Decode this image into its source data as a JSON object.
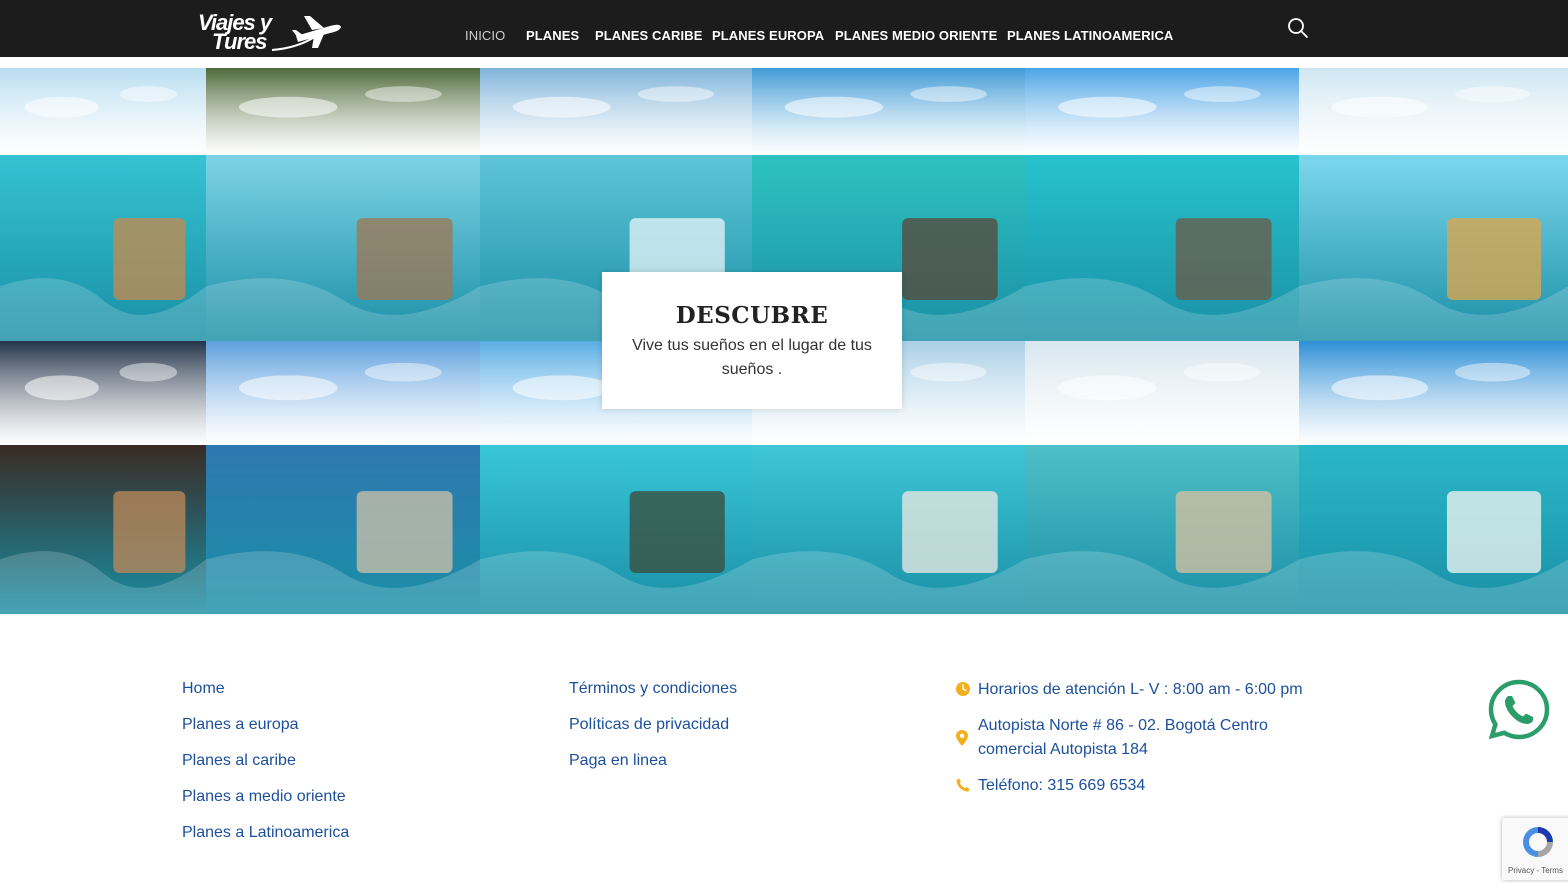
{
  "header": {
    "logo_line1": "Viajes y",
    "logo_line2": "Tures",
    "nav": [
      {
        "label": "INICIO",
        "active": true
      },
      {
        "label": "PLANES",
        "active": false
      },
      {
        "label": "PLANES CARIBE",
        "active": false
      },
      {
        "label": "PLANES EUROPA",
        "active": false
      },
      {
        "label": "PLANES MEDIO ORIENTE",
        "active": false
      },
      {
        "label": "PLANES LATINOAMERICA",
        "active": false
      }
    ],
    "search_icon": "search-icon"
  },
  "gallery": {
    "tiles": [
      {
        "subject": "overwater-breakfast-table",
        "sky": "#b8ddf0",
        "sea": "#35c3d2",
        "accent": "#c98a4a"
      },
      {
        "subject": "cliff-pool-villa",
        "sky": "#4e6a3a",
        "sea": "#7fd3e6",
        "accent": "#a07550"
      },
      {
        "subject": "water-bottle-pour",
        "sky": "#7fb3da",
        "sea": "#5fc5d8",
        "accent": "#e8f4f8"
      },
      {
        "subject": "overwater-bungalow-pier",
        "sky": "#3f9ad6",
        "sea": "#2ec2c0",
        "accent": "#5a4636"
      },
      {
        "subject": "ocean-villa-distance",
        "sky": "#4aa3e6",
        "sea": "#27c3cc",
        "accent": "#6e5a44"
      },
      {
        "subject": "cave-pool-breakfast",
        "sky": "#cfe6f2",
        "sea": "#7dd8ee",
        "accent": "#e2a548"
      },
      {
        "subject": "night-couple-mountain",
        "sky": "#24344a",
        "sea": "#3a2b24",
        "accent": "#c08a5a"
      },
      {
        "subject": "rock-tub-island",
        "sky": "#5d9fde",
        "sea": "#2f78b0",
        "accent": "#cfc2a8"
      },
      {
        "subject": "lagoon-bungalows",
        "sky": "#5aaee6",
        "sea": "#39c7d8",
        "accent": "#3b4b3a"
      },
      {
        "subject": "shell-house-pool",
        "sky": "#a9cfe6",
        "sea": "#3ec7d6",
        "accent": "#f0ebe2"
      },
      {
        "subject": "balcony-couple-lake",
        "sky": "#d7e6ef",
        "sea": "#4ec0c8",
        "accent": "#d9c2a0"
      },
      {
        "subject": "sandbar-ocean",
        "sky": "#2d8fd6",
        "sea": "#2ab8c8",
        "accent": "#f4f7f2"
      }
    ]
  },
  "card": {
    "title": "DESCUBRE",
    "text": "Vive tus sueños en el lugar de tus sueños ."
  },
  "footer": {
    "col1": [
      "Home",
      "Planes a europa",
      "Planes al caribe",
      "Planes a medio oriente",
      "Planes a Latinoamerica"
    ],
    "col2": [
      "Términos y condiciones",
      "Políticas de privacidad",
      "Paga en linea"
    ],
    "contact": {
      "hours": "Horarios de atención L- V : 8:00 am - 6:00 pm",
      "address": "Autopista Norte # 86 - 02. Bogotá Centro comercial Autopista 184",
      "phone": "Teléfono: 315 669 6534"
    },
    "icon_color": "#f2b01e",
    "link_color": "#1c4f9c"
  },
  "whatsapp": {
    "icon": "whatsapp-icon",
    "color": "#2a9d6a"
  },
  "recaptcha": {
    "terms": "Privacy - Terms"
  }
}
